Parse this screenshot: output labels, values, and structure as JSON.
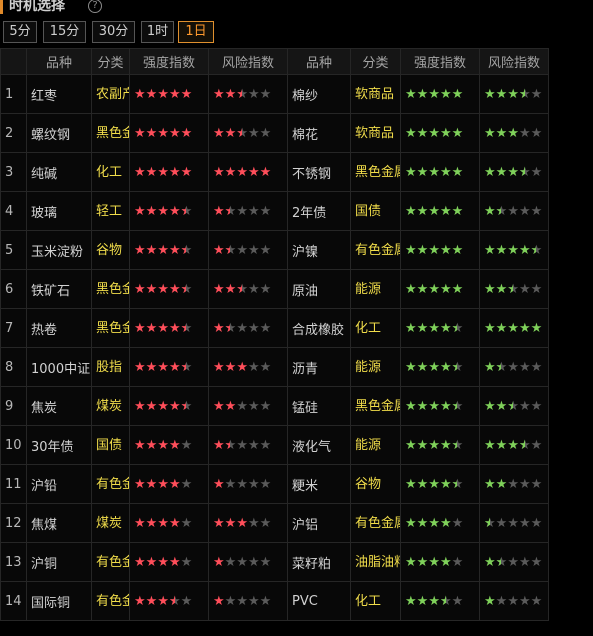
{
  "header": {
    "title": "时机选择",
    "help_icon": "?"
  },
  "tabs": [
    {
      "label": "5分",
      "active": false
    },
    {
      "label": "15分",
      "active": false
    },
    {
      "label": "30分",
      "active": false
    },
    {
      "label": "1时",
      "active": false
    },
    {
      "label": "1日",
      "active": true
    }
  ],
  "columns": [
    "品种",
    "分类",
    "强度指数",
    "风险指数",
    "品种",
    "分类",
    "强度指数",
    "风险指数"
  ],
  "colors": {
    "red_star": "#ff4e5a",
    "green_star": "#7fd15a",
    "empty_star": "#5a5a5a",
    "category": "#f0dc4a",
    "active_tab": "#ff9a2e"
  },
  "rows": [
    {
      "idx": "1",
      "l_name": "红枣",
      "l_cat": "农副产品",
      "l_strength": 5,
      "l_risk": 2.5,
      "r_name": "棉纱",
      "r_cat": "软商品",
      "r_strength": 5,
      "r_risk": 3.5
    },
    {
      "idx": "2",
      "l_name": "螺纹钢",
      "l_cat": "黑色金属",
      "l_strength": 5,
      "l_risk": 2.5,
      "r_name": "棉花",
      "r_cat": "软商品",
      "r_strength": 5,
      "r_risk": 3
    },
    {
      "idx": "3",
      "l_name": "纯碱",
      "l_cat": "化工",
      "l_strength": 5,
      "l_risk": 5,
      "r_name": "不锈钢",
      "r_cat": "黑色金属",
      "r_strength": 5,
      "r_risk": 3.5
    },
    {
      "idx": "4",
      "l_name": "玻璃",
      "l_cat": "轻工",
      "l_strength": 4.5,
      "l_risk": 1.5,
      "r_name": "2年债",
      "r_cat": "国债",
      "r_strength": 5,
      "r_risk": 1.5
    },
    {
      "idx": "5",
      "l_name": "玉米淀粉",
      "l_cat": "谷物",
      "l_strength": 4.5,
      "l_risk": 1.5,
      "r_name": "沪镍",
      "r_cat": "有色金属",
      "r_strength": 5,
      "r_risk": 4.5
    },
    {
      "idx": "6",
      "l_name": "铁矿石",
      "l_cat": "黑色金属",
      "l_strength": 4.5,
      "l_risk": 2.5,
      "r_name": "原油",
      "r_cat": "能源",
      "r_strength": 5,
      "r_risk": 2.5
    },
    {
      "idx": "7",
      "l_name": "热卷",
      "l_cat": "黑色金属",
      "l_strength": 4.5,
      "l_risk": 1.5,
      "r_name": "合成橡胶",
      "r_cat": "化工",
      "r_strength": 4.5,
      "r_risk": 5
    },
    {
      "idx": "8",
      "l_name": "1000中证",
      "l_cat": "股指",
      "l_strength": 4.5,
      "l_risk": 3,
      "r_name": "沥青",
      "r_cat": "能源",
      "r_strength": 4.5,
      "r_risk": 1.5
    },
    {
      "idx": "9",
      "l_name": "焦炭",
      "l_cat": "煤炭",
      "l_strength": 4.5,
      "l_risk": 2,
      "r_name": "锰硅",
      "r_cat": "黑色金属",
      "r_strength": 4.5,
      "r_risk": 2.5
    },
    {
      "idx": "10",
      "l_name": "30年债",
      "l_cat": "国债",
      "l_strength": 4,
      "l_risk": 1.5,
      "r_name": "液化气",
      "r_cat": "能源",
      "r_strength": 4.5,
      "r_risk": 3.5
    },
    {
      "idx": "11",
      "l_name": "沪铅",
      "l_cat": "有色金属",
      "l_strength": 4,
      "l_risk": 1,
      "r_name": "粳米",
      "r_cat": "谷物",
      "r_strength": 4.5,
      "r_risk": 2
    },
    {
      "idx": "12",
      "l_name": "焦煤",
      "l_cat": "煤炭",
      "l_strength": 4,
      "l_risk": 3,
      "r_name": "沪铝",
      "r_cat": "有色金属",
      "r_strength": 4,
      "r_risk": 0.5
    },
    {
      "idx": "13",
      "l_name": "沪铜",
      "l_cat": "有色金属",
      "l_strength": 4,
      "l_risk": 1,
      "r_name": "菜籽粕",
      "r_cat": "油脂油料",
      "r_strength": 4,
      "r_risk": 1.5
    },
    {
      "idx": "14",
      "l_name": "国际铜",
      "l_cat": "有色金属",
      "l_strength": 3.5,
      "l_risk": 1,
      "r_name": "PVC",
      "r_cat": "化工",
      "r_strength": 3.5,
      "r_risk": 1
    }
  ]
}
